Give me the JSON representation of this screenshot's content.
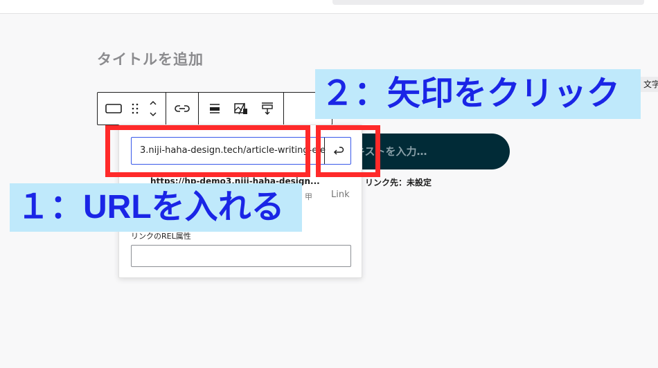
{
  "editor": {
    "title_placeholder": "タイトルを追加",
    "side_text": "文字"
  },
  "toolbar": {
    "block_type_icon": "button-icon",
    "drag_icon": "drag-handle-icon",
    "move_up_icon": "chevron-up-icon",
    "move_down_icon": "chevron-down-icon",
    "link_icon": "link-icon",
    "justify_icon": "justify-icon",
    "image_icon": "image-link-icon",
    "height_icon": "height-icon"
  },
  "button_block": {
    "text": "キストを入力…",
    "link_status": "リンク先：未設定",
    "bg_color": "#012b37"
  },
  "link_popover": {
    "url_value": "3.niji-haha-design.tech/article-writing-ele",
    "submit_icon": "enter-arrow-icon",
    "suggestion_url": "https://hp-demo3.niji-haha-design...",
    "suggestion_title": "甲",
    "suggestion_type": "Link",
    "rel_label": "リンクのREL属性",
    "rel_value": ""
  },
  "annotations": {
    "step1": "１：URLを入れる",
    "step2": "２：矢印をクリック",
    "highlight_color": "#ff2a2a",
    "label_bg": "#bfe9fb",
    "label_text_color": "#1a25e6"
  }
}
